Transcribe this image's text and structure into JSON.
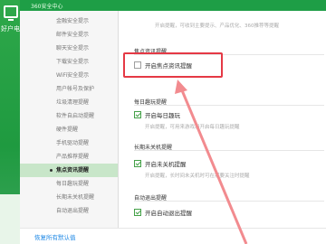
{
  "window": {
    "title": "360安全中心"
  },
  "background_app": {
    "label": "好户电脑"
  },
  "nav": {
    "items": [
      {
        "label": "金融安全提示"
      },
      {
        "label": "邮件安全提示"
      },
      {
        "label": "聊天安全提示"
      },
      {
        "label": "下载安全提示"
      },
      {
        "label": "WiFi安全提示"
      },
      {
        "label": "用户帐号及保护"
      },
      {
        "label": "垃圾清理提醒"
      },
      {
        "label": "软件自启动提醒"
      },
      {
        "label": "硬件提醒"
      },
      {
        "label": "手机驱动提醒"
      },
      {
        "label": "产品推荐提醒"
      },
      {
        "label": "焦点资讯提醒"
      },
      {
        "label": "每日趣玩提醒"
      },
      {
        "label": "长期未关机提醒"
      },
      {
        "label": "自动退出提醒"
      }
    ],
    "active_index": 11
  },
  "content": {
    "top_desc": "开启提醒，可收到主要提示、产品优化、360推荐等提醒",
    "sections": [
      {
        "title": "焦点资讯提醒",
        "checkbox_label": "开启焦点资讯提醒",
        "checked": false,
        "desc": ""
      },
      {
        "title": "每日趣玩提醒",
        "checkbox_label": "开启每日趣玩",
        "checked": true,
        "desc": "开启提醒，可用来游戏和开启每日趣玩提醒"
      },
      {
        "title": "长期未关机提醒",
        "checkbox_label": "开启未关机提醒",
        "checked": true,
        "desc": "开启提醒，长时间未关机时可在需要关注时提醒"
      },
      {
        "title": "自动退出提醒",
        "checkbox_label": "开启自动退出提醒",
        "checked": true,
        "desc": ""
      }
    ]
  },
  "footer": {
    "link_label": "恢复所有默认值"
  },
  "colors": {
    "accent": "#1e9e46",
    "highlight": "#e53945",
    "link": "#1e88e5"
  }
}
